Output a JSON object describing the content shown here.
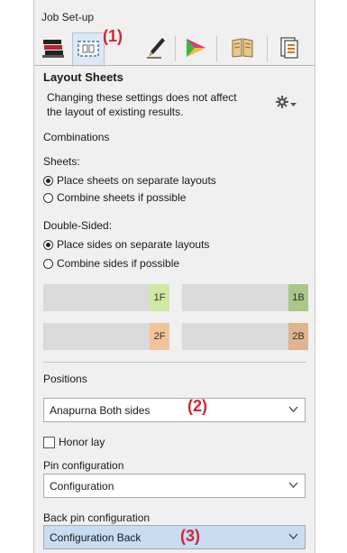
{
  "window_title": "Job Set-up",
  "toolbar": {
    "tools": [
      {
        "icon": "sheets-stack-icon",
        "active": false
      },
      {
        "icon": "layout-sheets-icon",
        "active": true
      },
      {
        "icon": "pen-icon",
        "active": false
      },
      {
        "icon": "color-triangle-icon",
        "active": false
      },
      {
        "icon": "book-icon",
        "active": false
      },
      {
        "icon": "document-icon",
        "active": false
      }
    ]
  },
  "callouts": {
    "one": "(1)",
    "two": "(2)",
    "three": "(3)"
  },
  "section": {
    "title": "Layout Sheets",
    "description": "Changing these settings does not affect the layout of existing results.",
    "settings_icon": "gear-icon"
  },
  "combinations": {
    "label": "Combinations",
    "sheets": {
      "label": "Sheets:",
      "options": [
        "Place sheets on separate layouts",
        "Combine sheets if possible"
      ],
      "selected": 0
    },
    "double_sided": {
      "label": "Double-Sided:",
      "options": [
        "Place sides on separate layouts",
        "Combine sides if possible"
      ],
      "selected": 0
    },
    "tiles": [
      {
        "tag": "1F",
        "color": "#cfe8a4"
      },
      {
        "tag": "1B",
        "color": "#a9c78a"
      },
      {
        "tag": "2F",
        "color": "#f2c49a"
      },
      {
        "tag": "2B",
        "color": "#ddb58e"
      }
    ]
  },
  "positions": {
    "label": "Positions",
    "value": "Anapurna Both sides",
    "honor_lay": {
      "label": "Honor lay",
      "checked": false
    }
  },
  "pin_configuration": {
    "label": "Pin configuration",
    "value": "Configuration"
  },
  "back_pin_configuration": {
    "label": "Back pin configuration",
    "value": "Configuration Back",
    "highlight": "#c8dcf2"
  },
  "colors": {
    "callout": "#d6262f",
    "panel": "#f0f0f0"
  }
}
